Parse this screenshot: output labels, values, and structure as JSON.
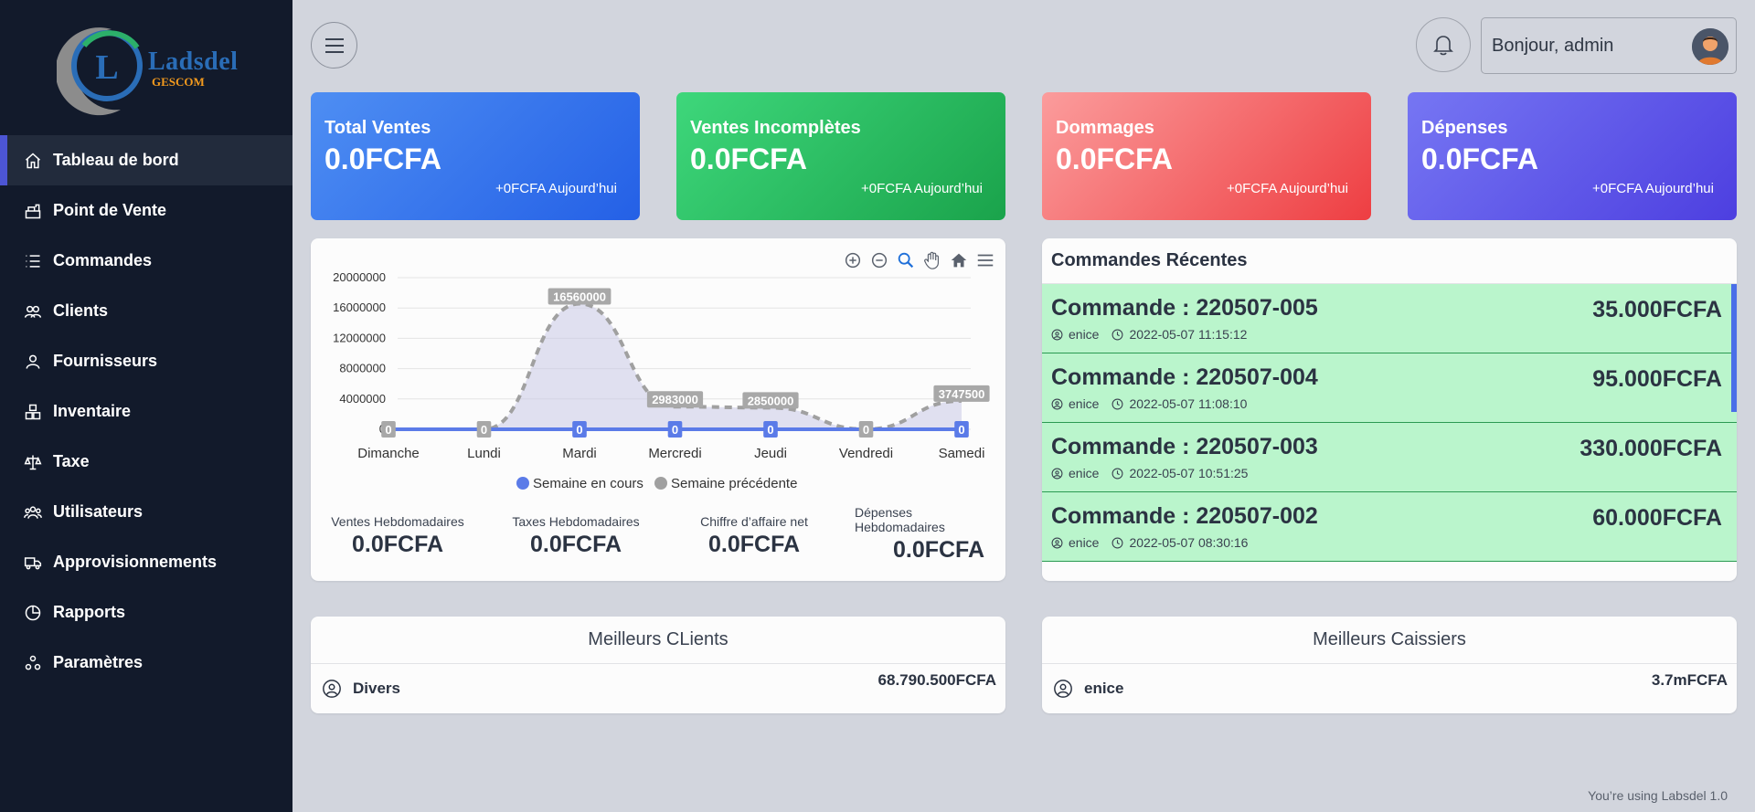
{
  "brand": {
    "name": "Ladsdel",
    "sub": "GESCOM",
    "initial": "L"
  },
  "sidebar": {
    "items": [
      {
        "label": "Tableau de bord",
        "icon": "home-icon"
      },
      {
        "label": "Point de Vente",
        "icon": "cash-register-icon"
      },
      {
        "label": "Commandes",
        "icon": "list-icon"
      },
      {
        "label": "Clients",
        "icon": "users-icon"
      },
      {
        "label": "Fournisseurs",
        "icon": "user-icon"
      },
      {
        "label": "Inventaire",
        "icon": "boxes-icon"
      },
      {
        "label": "Taxe",
        "icon": "scale-icon"
      },
      {
        "label": "Utilisateurs",
        "icon": "group-icon"
      },
      {
        "label": "Approvisionnements",
        "icon": "truck-icon"
      },
      {
        "label": "Rapports",
        "icon": "pie-icon"
      },
      {
        "label": "Paramètres",
        "icon": "settings-icon"
      }
    ]
  },
  "topbar": {
    "greeting": "Bonjour, admin"
  },
  "cards": [
    {
      "title": "Total Ventes",
      "value": "0.0FCFA",
      "today": "+0FCFA Aujourd’hui"
    },
    {
      "title": "Ventes Incomplètes",
      "value": "0.0FCFA",
      "today": "+0FCFA Aujourd’hui"
    },
    {
      "title": "Dommages",
      "value": "0.0FCFA",
      "today": "+0FCFA Aujourd’hui"
    },
    {
      "title": "Dépenses",
      "value": "0.0FCFA",
      "today": "+0FCFA Aujourd’hui"
    }
  ],
  "chart_data": {
    "type": "area",
    "categories": [
      "Dimanche",
      "Lundi",
      "Mardi",
      "Mercredi",
      "Jeudi",
      "Vendredi",
      "Samedi"
    ],
    "series": [
      {
        "name": "Semaine en cours",
        "color": "#5b7be8",
        "values": [
          0,
          0,
          0,
          0,
          0,
          0,
          0
        ]
      },
      {
        "name": "Semaine précédente",
        "color": "#a0a0a0",
        "values": [
          0,
          0,
          16560000,
          2983000,
          2850000,
          0,
          3747500
        ]
      }
    ],
    "ylim": [
      0,
      20000000
    ],
    "yticks": [
      "20000000",
      "16000000",
      "12000000",
      "8000000",
      "4000000",
      "0"
    ],
    "grid": true,
    "legend": "bottom"
  },
  "weekly": [
    {
      "label": "Ventes Hebdomadaires",
      "value": "0.0FCFA"
    },
    {
      "label": "Taxes Hebdomadaires",
      "value": "0.0FCFA"
    },
    {
      "label": "Chiffre d’affaire net",
      "value": "0.0FCFA"
    },
    {
      "label": "Dépenses Hebdomadaires",
      "value": "0.0FCFA"
    }
  ],
  "orders": {
    "title": "Commandes Récentes",
    "items": [
      {
        "name": "Commande : 220507-005",
        "amount": "35.000FCFA",
        "user": "enice",
        "date": "2022-05-07 11:15:12"
      },
      {
        "name": "Commande : 220507-004",
        "amount": "95.000FCFA",
        "user": "enice",
        "date": "2022-05-07 11:08:10"
      },
      {
        "name": "Commande : 220507-003",
        "amount": "330.000FCFA",
        "user": "enice",
        "date": "2022-05-07 10:51:25"
      },
      {
        "name": "Commande : 220507-002",
        "amount": "60.000FCFA",
        "user": "enice",
        "date": "2022-05-07 08:30:16"
      }
    ]
  },
  "best_clients": {
    "title": "Meilleurs CLients",
    "name": "Divers",
    "amount": "68.790.500FCFA"
  },
  "best_cashiers": {
    "title": "Meilleurs Caissiers",
    "name": "enice",
    "amount": "3.7mFCFA"
  },
  "footer": "You’re using Labsdel 1.0"
}
